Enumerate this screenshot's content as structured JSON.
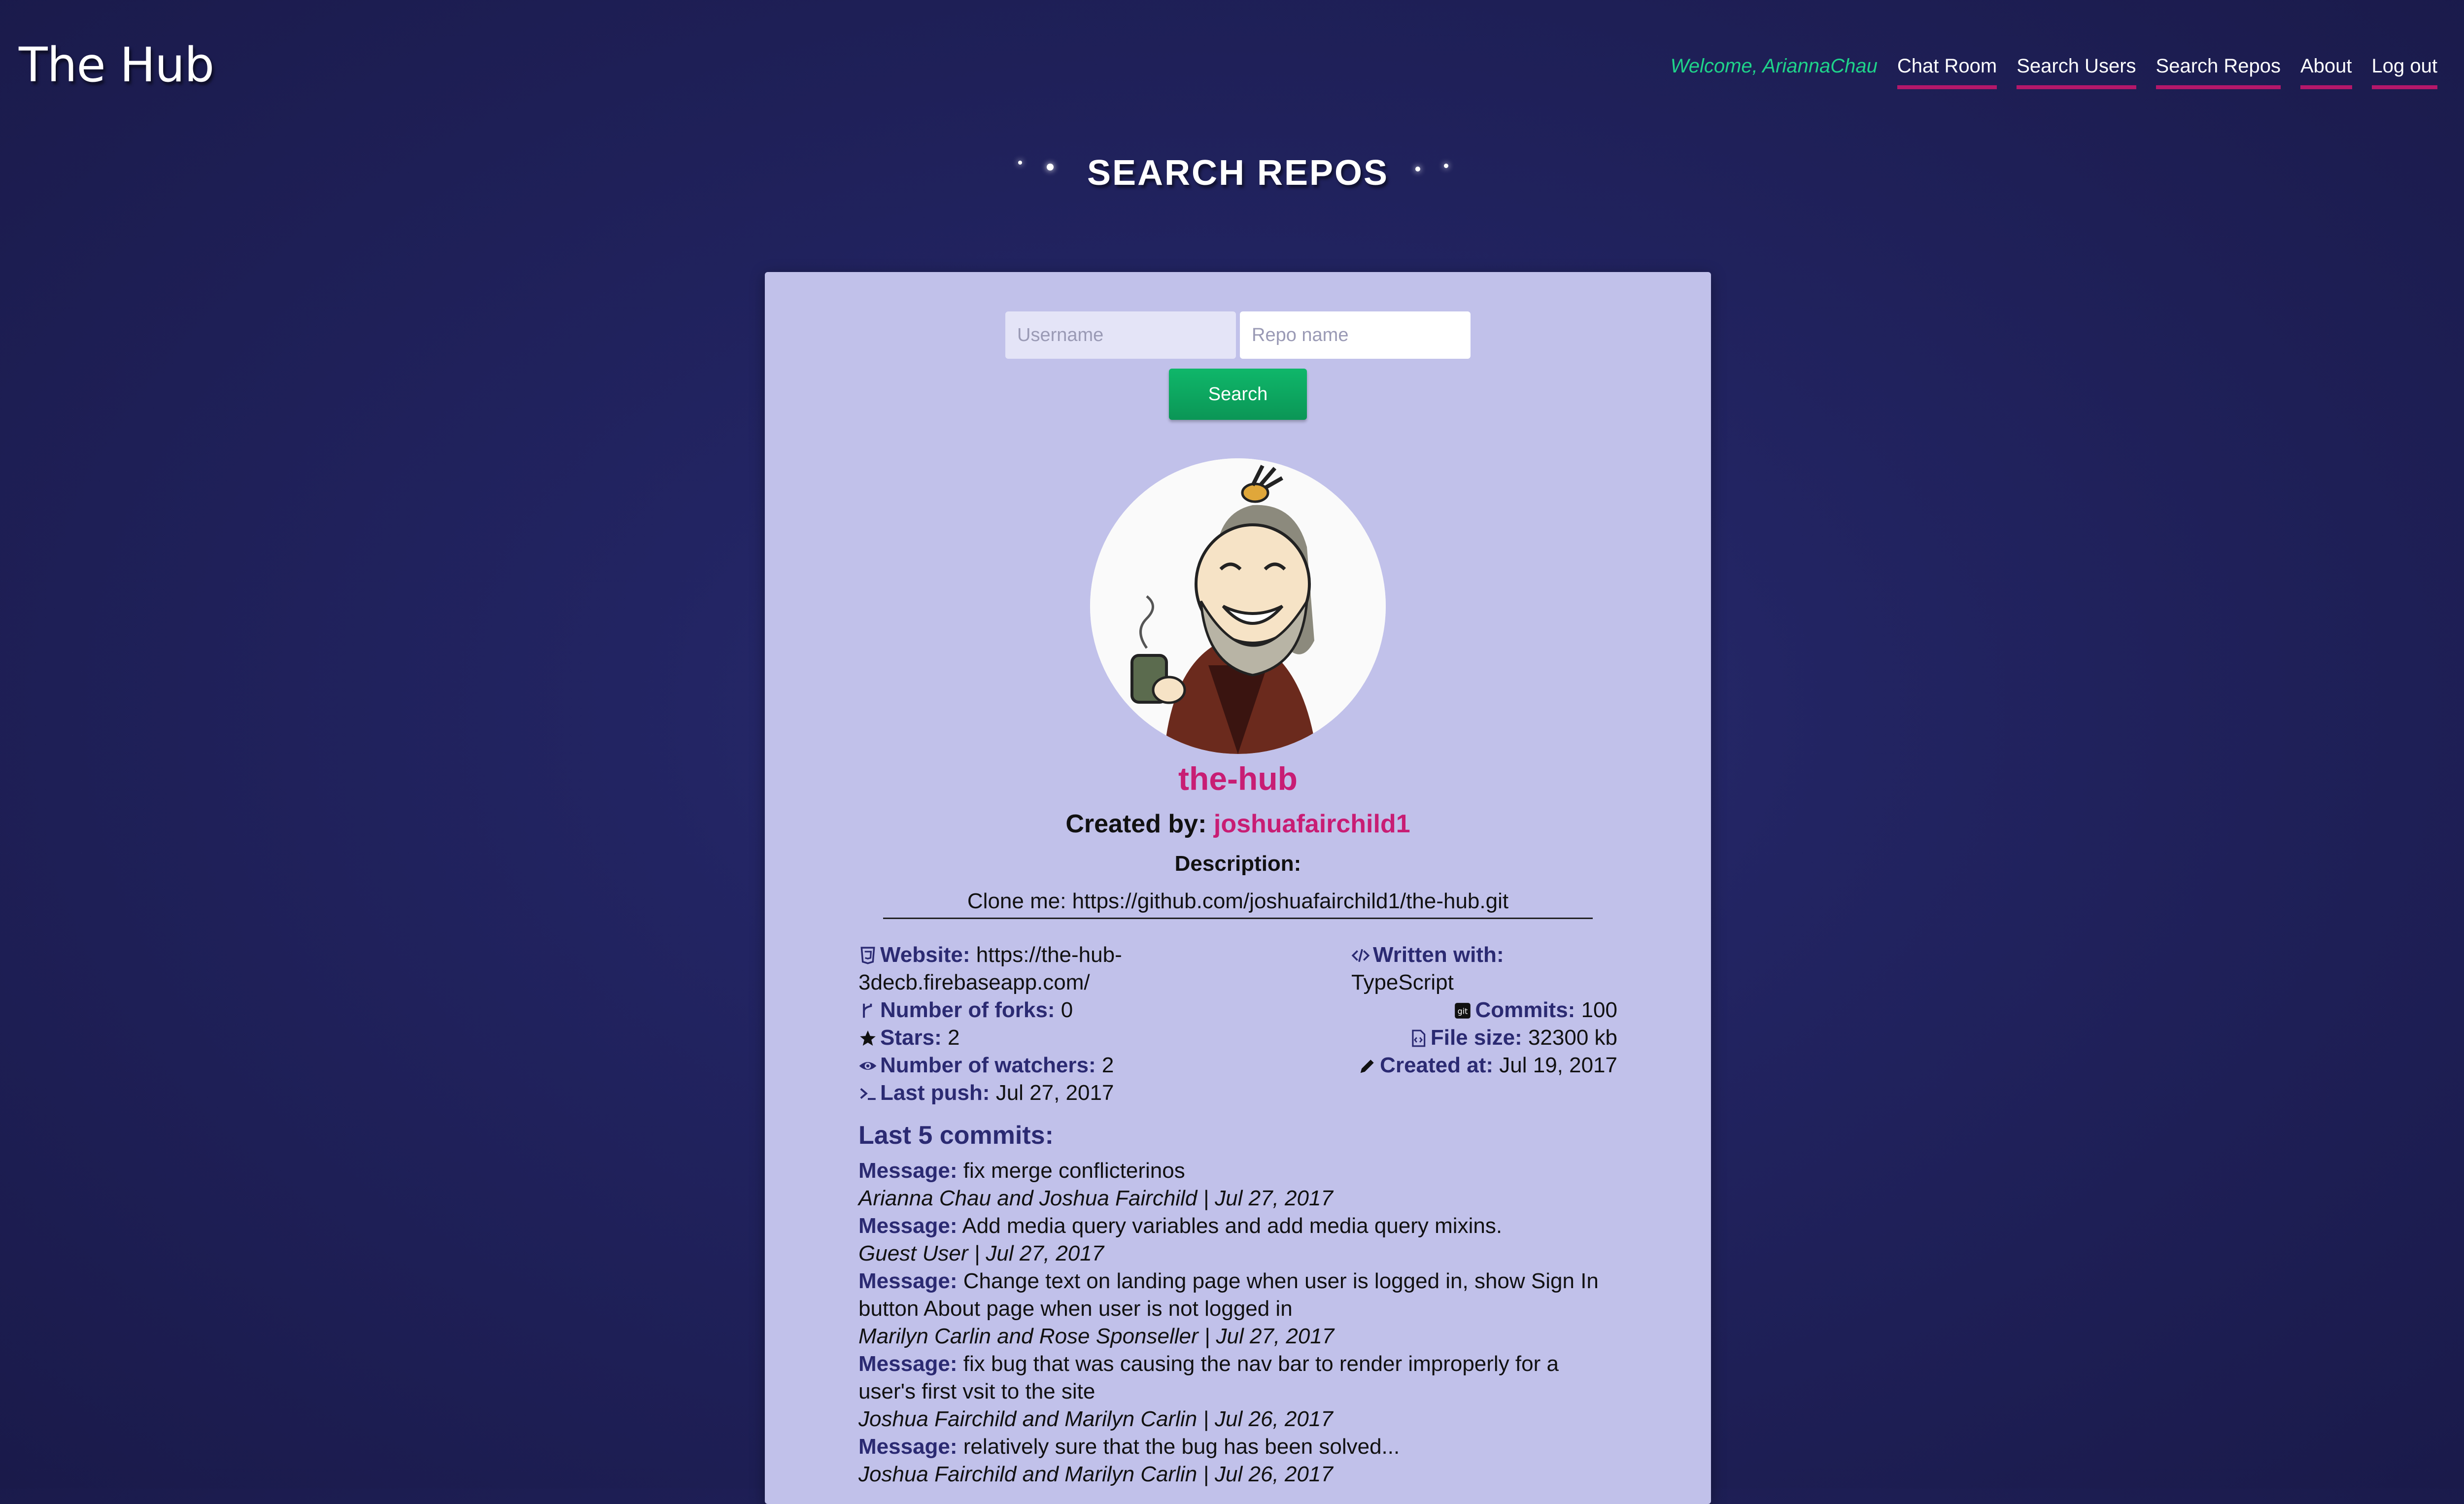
{
  "app": {
    "title": "The Hub"
  },
  "nav": {
    "welcome": "Welcome, AriannaChau",
    "items": [
      "Chat Room",
      "Search Users",
      "Search Repos",
      "About",
      "Log out"
    ]
  },
  "page": {
    "title": "SEARCH REPOS"
  },
  "search": {
    "username_placeholder": "Username",
    "repo_placeholder": "Repo name",
    "button": "Search"
  },
  "repo": {
    "name": "the-hub",
    "created_by_label": "Created by:",
    "owner": "joshuafairchild1",
    "description_label": "Description:",
    "description": "Clone me: https://github.com/joshuafairchild1/the-hub.git",
    "website_label": "Website:",
    "website": "https://the-hub-3decb.firebaseapp.com/",
    "forks_label": "Number of forks:",
    "forks": "0",
    "stars_label": "Stars:",
    "stars": "2",
    "watchers_label": "Number of watchers:",
    "watchers": "2",
    "last_push_label": "Last push:",
    "last_push": "Jul 27, 2017",
    "written_label": "Written with:",
    "written": "TypeScript",
    "commits_label": "Commits:",
    "commits": "100",
    "size_label": "File size:",
    "size": "32300 kb",
    "created_at_label": "Created at:",
    "created_at": "Jul 19, 2017"
  },
  "commits": {
    "heading": "Last 5 commits:",
    "message_label": "Message:",
    "items": [
      {
        "message": "fix merge conflicterinos",
        "by": "Arianna Chau and Joshua Fairchild | Jul 27, 2017"
      },
      {
        "message": "Add media query variables and add media query mixins.",
        "by": "Guest User | Jul 27, 2017"
      },
      {
        "message": "Change text on landing page when user is logged in, show Sign In button About page when user is not logged in",
        "by": "Marilyn Carlin and Rose Sponseller | Jul 27, 2017"
      },
      {
        "message": "fix bug that was causing the nav bar to render improperly for a user's first vsit to the site",
        "by": "Joshua Fairchild and Marilyn Carlin | Jul 26, 2017"
      },
      {
        "message": "relatively sure that the bug has been solved...",
        "by": "Joshua Fairchild and Marilyn Carlin | Jul 26, 2017"
      }
    ]
  },
  "colors": {
    "background": "#222462",
    "card": "#c1c1ea",
    "accent_pink": "#c81d74",
    "welcome_green": "#1fd38a",
    "button_green": "#0fb76a",
    "label_navy": "#2b2a72"
  },
  "icons": [
    "html5-icon",
    "fork-icon",
    "star-icon",
    "eye-icon",
    "terminal-icon",
    "code-icon",
    "git-icon",
    "file-code-icon",
    "pencil-icon"
  ]
}
